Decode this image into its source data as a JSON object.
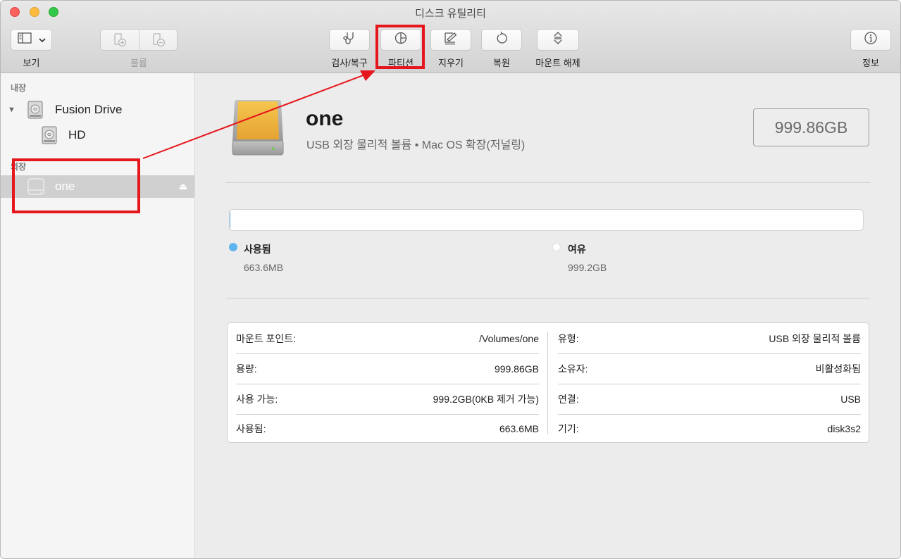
{
  "window": {
    "title": "디스크 유틸리티"
  },
  "toolbar": {
    "view": {
      "label": "보기",
      "icon": "sidebar-icon",
      "chevron": "chevron-down-icon"
    },
    "volume": {
      "label": "볼륨",
      "add_icon": "add-volume-icon",
      "remove_icon": "remove-volume-icon",
      "enabled": false
    },
    "first_aid": {
      "label": "검사/복구",
      "icon": "stethoscope-icon"
    },
    "partition": {
      "label": "파티션",
      "icon": "partition-pie-icon"
    },
    "erase": {
      "label": "지우기",
      "icon": "erase-icon"
    },
    "restore": {
      "label": "복원",
      "icon": "restore-icon"
    },
    "unmount": {
      "label": "마운트 해제",
      "icon": "unmount-icon"
    },
    "info": {
      "label": "정보",
      "icon": "info-icon"
    }
  },
  "sidebar": {
    "sections": [
      {
        "title": "내장",
        "items": [
          {
            "label": "Fusion Drive",
            "icon": "internal-disk-icon",
            "expanded": true
          },
          {
            "label": "HD",
            "icon": "internal-disk-icon"
          }
        ]
      },
      {
        "title": "외장",
        "items": [
          {
            "label": "one",
            "icon": "external-disk-icon",
            "selected": true,
            "eject_icon": "eject-icon"
          }
        ]
      }
    ]
  },
  "volume": {
    "name": "one",
    "description": "USB 외장 물리적 볼륨 • Mac OS 확장(저널링)",
    "size": "999.86GB",
    "usage_fraction": 0.00066,
    "colors": {
      "used": "#5fb4ee",
      "free": "#ffffff",
      "drive": "#f0b53e"
    },
    "legend": {
      "used": {
        "label": "사용됨",
        "value": "663.6MB"
      },
      "free": {
        "label": "여유",
        "value": "999.2GB"
      }
    }
  },
  "info": {
    "left": [
      {
        "label": "마운트 포인트:",
        "value": "/Volumes/one"
      },
      {
        "label": "용량:",
        "value": "999.86GB"
      },
      {
        "label": "사용 가능:",
        "value": "999.2GB(0KB 제거 가능)"
      },
      {
        "label": "사용됨:",
        "value": "663.6MB"
      }
    ],
    "right": [
      {
        "label": "유형:",
        "value": "USB 외장 물리적 볼륨"
      },
      {
        "label": "소유자:",
        "value": "비활성화됨"
      },
      {
        "label": "연결:",
        "value": "USB"
      },
      {
        "label": "기기:",
        "value": "disk3s2"
      }
    ]
  },
  "annotation": {
    "color": "#e6161d"
  }
}
